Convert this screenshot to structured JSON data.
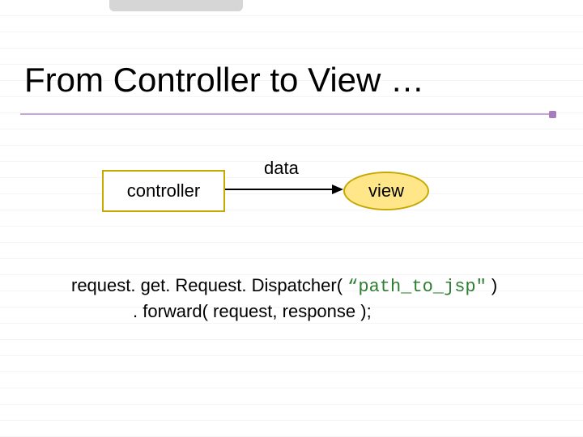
{
  "title": "From Controller to View …",
  "diagram": {
    "controller_label": "controller",
    "data_label": "data",
    "view_label": "view"
  },
  "code": {
    "line1_pre": "request. get. Request. Dispatcher( ",
    "line1_path": "“path_to_jsp\"",
    "line1_post": " )",
    "line2": ". forward( request, response );"
  }
}
